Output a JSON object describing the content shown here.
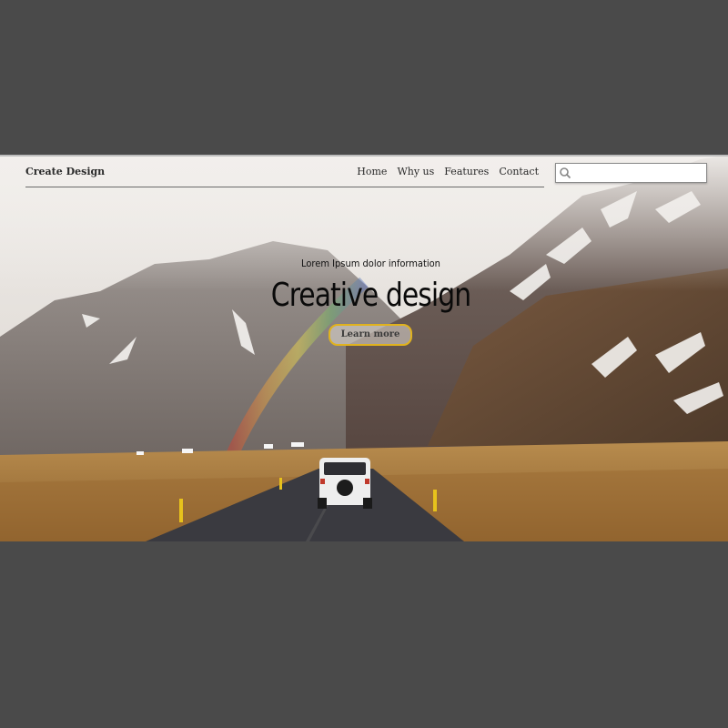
{
  "header": {
    "brand": "Create Design",
    "nav": [
      "Home",
      "Why us",
      "Features",
      "Contact"
    ],
    "search": {
      "placeholder": "",
      "value": ""
    }
  },
  "hero": {
    "subtitle": "Lorem Ipsum dolor information",
    "title": "Creative design",
    "cta_label": "Learn more"
  },
  "colors": {
    "page_background": "#4a4a4a",
    "cta_border": "#e0b21e"
  },
  "icons": [
    "search-icon"
  ]
}
